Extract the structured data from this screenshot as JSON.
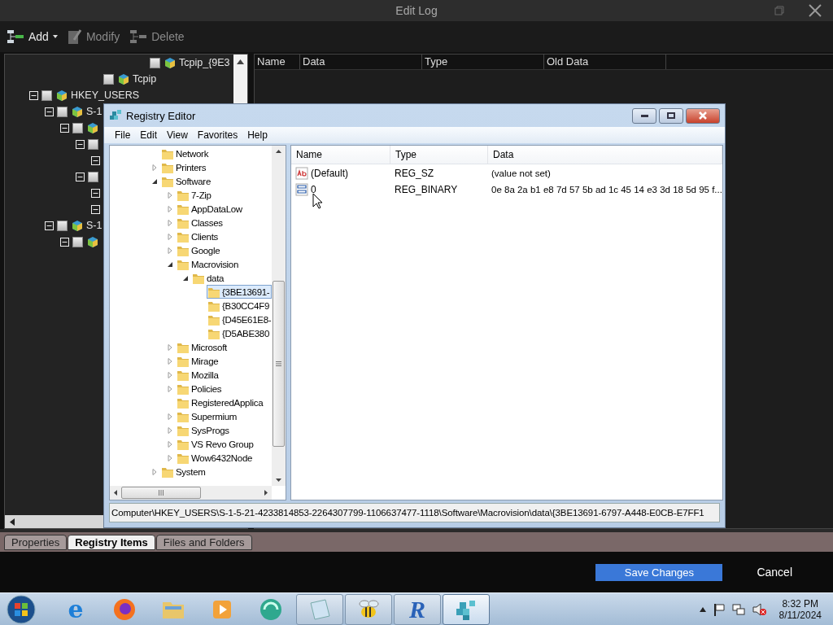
{
  "edit_log": {
    "title": "Edit Log",
    "toolbar": [
      {
        "kind": "add",
        "label": "Add",
        "disabled": false
      },
      {
        "kind": "modify",
        "label": "Modify",
        "disabled": true
      },
      {
        "kind": "delete",
        "label": "Delete",
        "disabled": true
      }
    ],
    "tree": [
      {
        "children": [
          {
            "children": [
              {
                "children": [
                  {
                    "children": [
                      {
                        "children": [
                          {
                            "children": [
                              {
                                "children": [
                                  {
                                    "label": "Tcpip_{9E3",
                                    "checked": false
                                  }
                                ]
                              }
                            ]
                          }
                        ]
                      },
                      {
                        "label": "Tcpip",
                        "checked": false
                      }
                    ]
                  }
                ]
              }
            ]
          }
        ]
      },
      {
        "label": "HKEY_USERS",
        "expanded": true,
        "checked": false,
        "children": [
          {
            "label": "S-1",
            "expanded": true,
            "checked": false,
            "children": [
              {
                "expanded": true,
                "checked": false,
                "children": [
                  {
                    "expanded": true,
                    "checked": false,
                    "children": [
                      {
                        "expanded": true
                      }
                    ]
                  },
                  {
                    "expanded": true,
                    "checked": false,
                    "children": [
                      {
                        "expanded": true
                      },
                      {
                        "expanded": true
                      }
                    ]
                  }
                ]
              }
            ]
          },
          {
            "label": "S-1",
            "expanded": true,
            "checked": false,
            "children": [
              {
                "expanded": true,
                "checked": false
              }
            ]
          }
        ]
      }
    ],
    "columns": [
      "Name",
      "Data",
      "Type",
      "Old Data"
    ],
    "tabs": [
      {
        "label": "Properties",
        "selected": false
      },
      {
        "label": "Registry Items",
        "selected": true
      },
      {
        "label": "Files and Folders",
        "selected": false
      }
    ],
    "save_button": "Save Changes",
    "cancel_button": "Cancel"
  },
  "registry_editor": {
    "title": "Registry Editor",
    "menu": [
      "File",
      "Edit",
      "View",
      "Favorites",
      "Help"
    ],
    "tree": [
      {
        "label": "Network",
        "selected": false
      },
      {
        "label": "Printers",
        "expanded": false,
        "selected": false
      },
      {
        "label": "Software",
        "expanded": true,
        "selected": false,
        "children": [
          {
            "label": "7-Zip",
            "expanded": false,
            "selected": false
          },
          {
            "label": "AppDataLow",
            "expanded": false,
            "selected": false
          },
          {
            "label": "Classes",
            "expanded": false,
            "selected": false
          },
          {
            "label": "Clients",
            "expanded": false,
            "selected": false
          },
          {
            "label": "Google",
            "expanded": false,
            "selected": false
          },
          {
            "label": "Macrovision",
            "expanded": true,
            "selected": false,
            "children": [
              {
                "label": "data",
                "expanded": true,
                "selected": false,
                "children": [
                  {
                    "label": "{3BE13691-",
                    "selected": true
                  },
                  {
                    "label": "{B30CC4F9",
                    "selected": false
                  },
                  {
                    "label": "{D45E61E8-",
                    "selected": false
                  },
                  {
                    "label": "{D5ABE380",
                    "selected": false
                  }
                ]
              }
            ]
          },
          {
            "label": "Microsoft",
            "expanded": false,
            "selected": false
          },
          {
            "label": "Mirage",
            "expanded": false,
            "selected": false
          },
          {
            "label": "Mozilla",
            "expanded": false,
            "selected": false
          },
          {
            "label": "Policies",
            "expanded": false,
            "selected": false
          },
          {
            "label": "RegisteredApplica",
            "selected": false
          },
          {
            "label": "Supermium",
            "expanded": false,
            "selected": false
          },
          {
            "label": "SysProgs",
            "expanded": false,
            "selected": false
          },
          {
            "label": "VS Revo Group",
            "expanded": false,
            "selected": false
          },
          {
            "label": "Wow6432Node",
            "expanded": false,
            "selected": false
          }
        ]
      },
      {
        "label": "System",
        "expanded": false,
        "selected": false
      }
    ],
    "columns": [
      "Name",
      "Type",
      "Data"
    ],
    "values": [
      {
        "kind": "string",
        "name": "(Default)",
        "type": "REG_SZ",
        "data": "(value not set)"
      },
      {
        "kind": "binary",
        "name": "0",
        "type": "REG_BINARY",
        "data": "0e 8a 2a b1 e8 7d 57 5b ad 1c 45 14 e3 3d 18 5d 95 f..."
      }
    ],
    "status": "Computer\\HKEY_USERS\\S-1-5-21-4233814853-2264307799-1106637477-1118\\Software\\Macrovision\\data\\{3BE13691-6797-A448-E0CB-E7FF1"
  },
  "taskbar": {
    "apps": [
      {
        "kind": "ie",
        "glyph": "e",
        "running": false,
        "selected": false
      },
      {
        "kind": "firefox",
        "running": false,
        "selected": false
      },
      {
        "kind": "explorer",
        "running": false,
        "selected": false
      },
      {
        "kind": "media",
        "running": false,
        "selected": false
      },
      {
        "kind": "green",
        "running": false,
        "selected": false
      },
      {
        "kind": "notepad",
        "running": true,
        "selected": false
      },
      {
        "kind": "bee",
        "running": true,
        "selected": false
      },
      {
        "kind": "r",
        "glyph": "R",
        "running": true,
        "selected": false
      },
      {
        "kind": "regedit",
        "running": true,
        "selected": true
      }
    ],
    "time": "8:32 PM",
    "date": "8/11/2024"
  }
}
